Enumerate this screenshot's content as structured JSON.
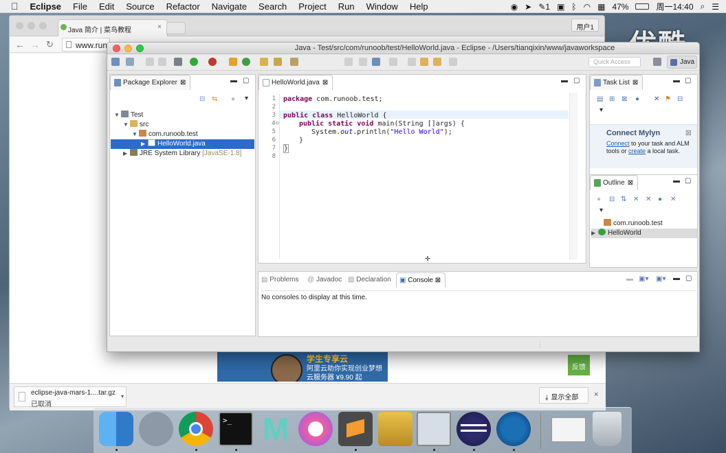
{
  "menubar": {
    "app": "Eclipse",
    "items": [
      "File",
      "Edit",
      "Source",
      "Refactor",
      "Navigate",
      "Search",
      "Project",
      "Run",
      "Window",
      "Help"
    ],
    "battery": "47%",
    "clock": "周一14:40",
    "badge": "1"
  },
  "browser": {
    "tab_title": "Java 简介 | 菜鸟教程",
    "tab_close": "×",
    "user": "用户1",
    "url": "www.runo",
    "ad": {
      "line1": "学生专享云",
      "line2": "阿里云助你实现创业梦想",
      "line3": "云服务器 ¥9.90 起"
    },
    "feedback": "反馈",
    "download": {
      "name": "eclipse-java-mars-1....tar.gz",
      "status": "已取消"
    },
    "show_all": "显示全部",
    "close": "×"
  },
  "watermark": "优酷",
  "eclipse": {
    "title": "Java - Test/src/com/runoob/test/HelloWorld.java - Eclipse - /Users/tianqixin/www/javaworkspace",
    "quick_access": "Quick Access",
    "perspective": "Java",
    "package_explorer": {
      "tab": "Package Explorer",
      "tree": [
        {
          "label": "Test"
        },
        {
          "label": "src"
        },
        {
          "label": "com.runoob.test"
        },
        {
          "label": "HelloWorld.java"
        },
        {
          "label": "JRE System Library",
          "suffix": "[JavaSE-1.8]"
        }
      ]
    },
    "editor": {
      "tab": "HelloWorld.java",
      "line_numbers": [
        "1",
        "2",
        "3",
        "4",
        "5",
        "6",
        "7",
        "8"
      ],
      "lines": {
        "l1_kw": "package",
        "l1": " com.runoob.test;",
        "l3_kw1": "public",
        "l3_kw2": "class",
        "l3": " HelloWorld {",
        "l4_kw1": "public",
        "l4_kw2": "static",
        "l4_kw3": "void",
        "l4": " main(String []args) {",
        "l5_a": "System.",
        "l5_out": "out",
        "l5_b": ".println(",
        "l5_str": "\"Hello World\"",
        "l5_c": ");",
        "l6": "}",
        "l7": "}"
      }
    },
    "task_list": {
      "tab": "Task List"
    },
    "mylyn": {
      "title": "Connect Mylyn",
      "link1": "Connect",
      "text1": " to your task and ALM tools or ",
      "link2": "create",
      "text2": " a local task."
    },
    "outline": {
      "tab": "Outline",
      "items": [
        "com.runoob.test",
        "HelloWorld"
      ]
    },
    "bottom": {
      "tabs": [
        "Problems",
        "Javadoc",
        "Declaration",
        "Console"
      ],
      "console_text": "No consoles to display at this time."
    }
  },
  "dock": {
    "apps": [
      "finder-icon",
      "launchpad-icon",
      "chrome-icon",
      "terminal-icon",
      "mindnode-icon",
      "itunes-icon",
      "sublime-text-icon",
      "transmit-icon",
      "preview-icon",
      "eclipse-icon",
      "quicktime-icon",
      "window-thumbnail",
      "trash-icon"
    ]
  }
}
